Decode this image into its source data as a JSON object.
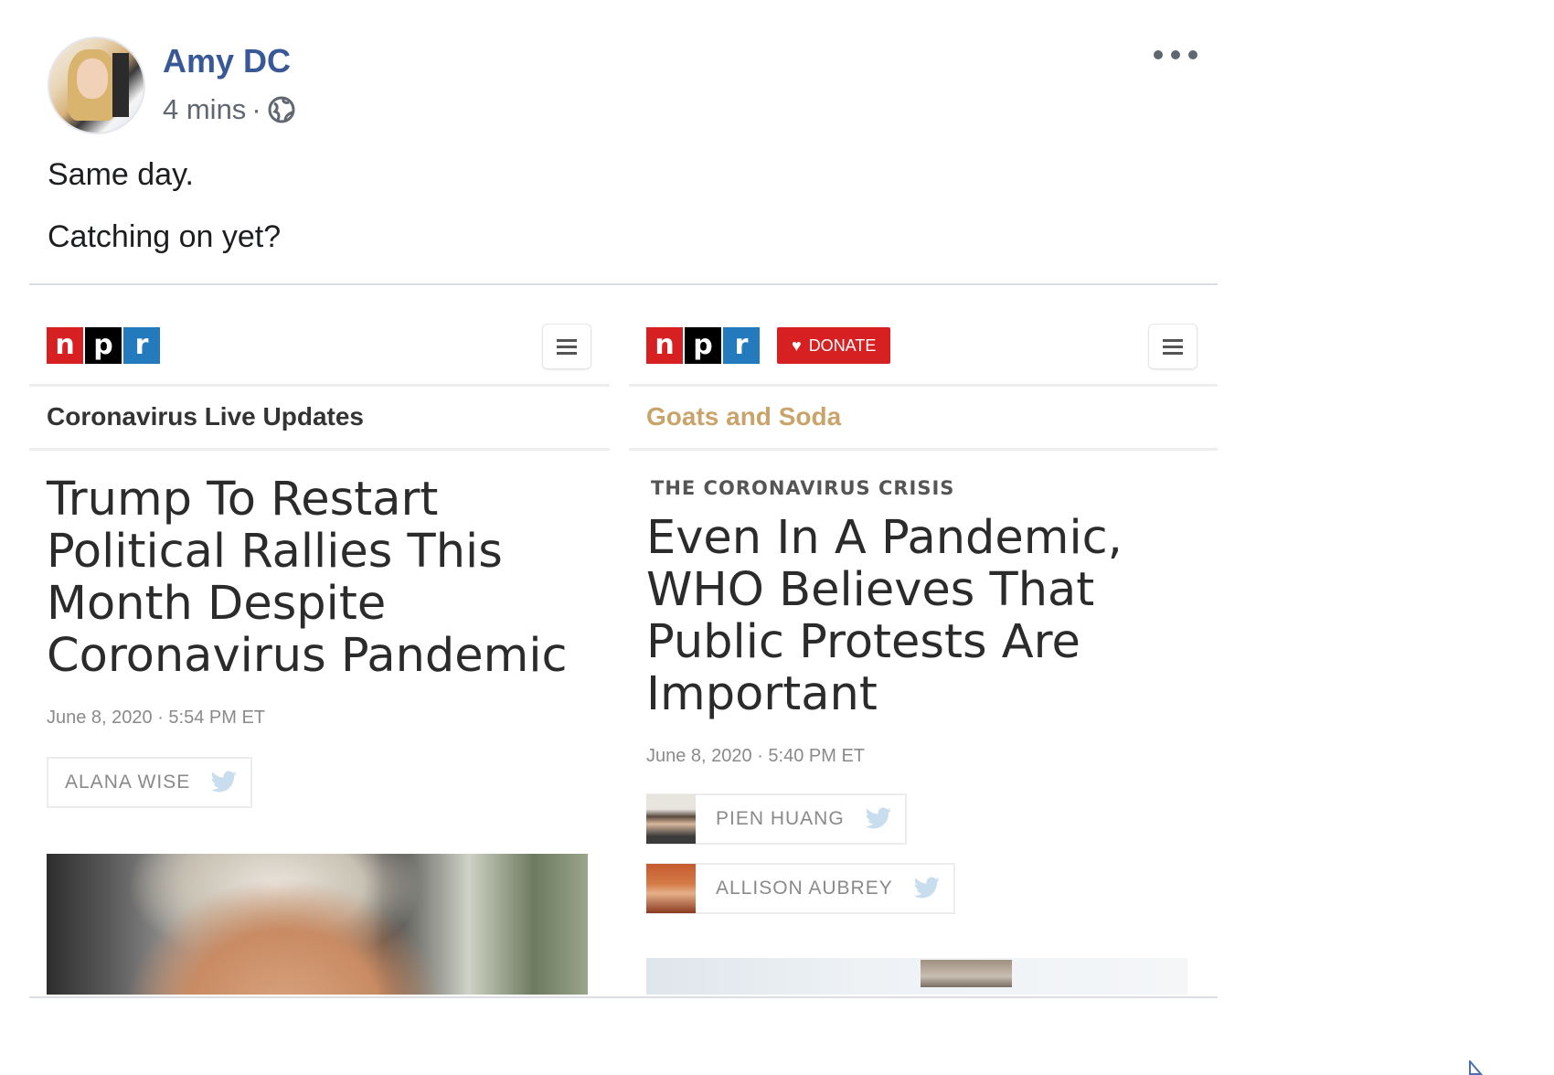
{
  "post": {
    "author": "Amy DC",
    "time": "4 mins",
    "privacy_icon": "globe-icon",
    "more_icon": "more-options-icon",
    "text_lines": [
      "Same day.",
      "Catching on yet?"
    ]
  },
  "articles": [
    {
      "logo_letters": [
        "n",
        "p",
        "r"
      ],
      "section": "Coronavirus Live Updates",
      "headline": "Trump To Restart Political Rallies This Month Despite Coronavirus Pandemic",
      "date": "June 8, 2020 · 5:54 PM ET",
      "authors": [
        "ALANA WISE"
      ]
    },
    {
      "logo_letters": [
        "n",
        "p",
        "r"
      ],
      "donate_label": "DONATE",
      "section": "Goats and Soda",
      "kicker": "THE CORONAVIRUS CRISIS",
      "headline": "Even In A Pandemic, WHO Believes That Public Protests Are Important",
      "date": "June 8, 2020 · 5:40 PM ET",
      "authors": [
        "PIEN HUANG",
        "ALLISON AUBREY"
      ]
    }
  ],
  "colors": {
    "author_link": "#385898",
    "npr_red": "#d62021",
    "npr_blue": "#237bbd",
    "goats_gold": "#c9a46a"
  }
}
